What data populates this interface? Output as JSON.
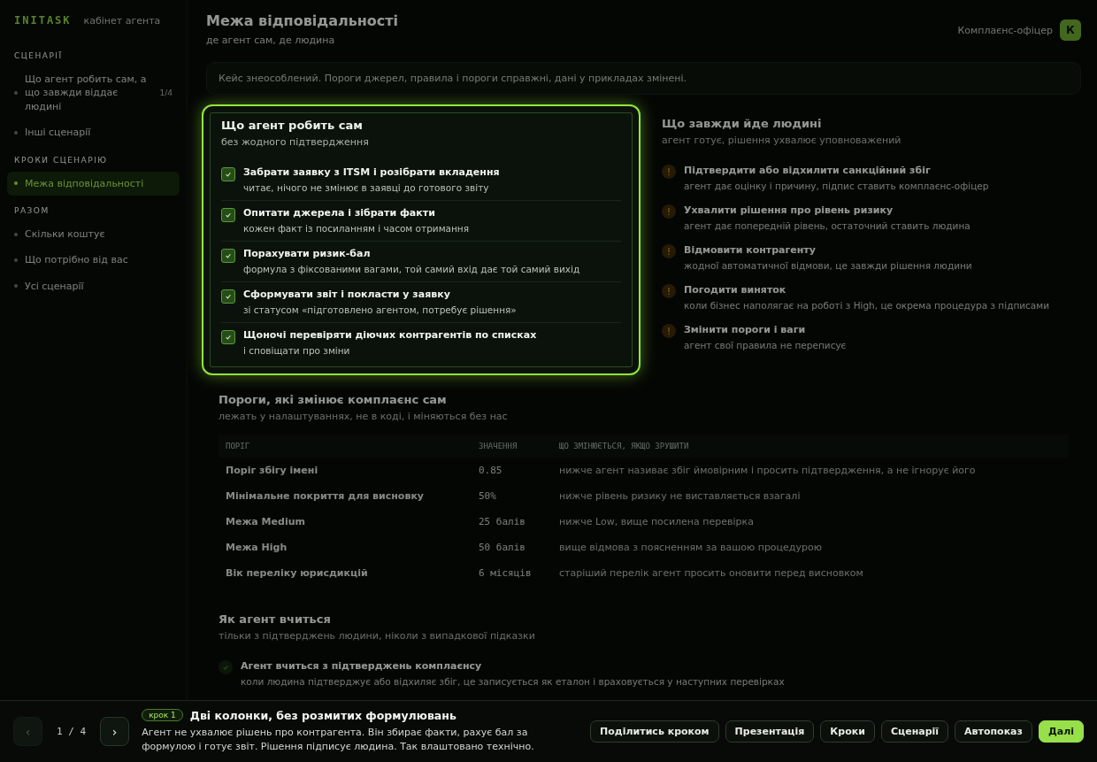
{
  "sidebar": {
    "logo": "INITASK",
    "subtitle": "кабінет агента",
    "sections": [
      {
        "title": "СЦЕНАРІЇ",
        "items": [
          {
            "label": "Що агент робить сам, а що завжди віддає людині",
            "badge": "1/4",
            "selected": false
          },
          {
            "label": "Інші сценарії",
            "selected": false
          }
        ]
      },
      {
        "title": "КРОКИ СЦЕНАРІЮ",
        "items": [
          {
            "label": "Межа відповідальності",
            "selected": true
          }
        ]
      },
      {
        "title": "РАЗОМ",
        "items": [
          {
            "label": "Скільки коштує",
            "selected": false
          },
          {
            "label": "Що потрібно від вас",
            "selected": false
          },
          {
            "label": "Усі сценарії",
            "selected": false
          }
        ]
      }
    ]
  },
  "header": {
    "title": "Межа відповідальності",
    "subtitle": "де агент сам, де людина",
    "user": {
      "name": "Комплаєнс-офіцер",
      "initial": "К"
    }
  },
  "notice": "Кейс знеособлений. Пороги джерел, правила і пороги справжні, дані у прикладах змінені.",
  "agent_column": {
    "spotlight": true,
    "title": "Що агент робить сам",
    "subtitle": "без жодного підтвердження",
    "items": [
      {
        "title": "Забрати заявку з ITSM і розібрати вкладення",
        "detail": "читає, нічого не змінює в заявці до готового звіту",
        "checked": true
      },
      {
        "title": "Опитати джерела і зібрати факти",
        "detail": "кожен факт із посиланням і часом отримання",
        "checked": true
      },
      {
        "title": "Порахувати ризик-бал",
        "detail": "формула з фіксованими вагами, той самий вхід дає той самий вихід",
        "checked": true
      },
      {
        "title": "Сформувати звіт і покласти у заявку",
        "detail": "зі статусом «підготовлено агентом, потребує рішення»",
        "checked": true
      },
      {
        "title": "Щоночі перевіряти діючих контрагентів по списках",
        "detail": "і сповіщати про зміни",
        "checked": true
      }
    ]
  },
  "human_column": {
    "title": "Що завжди йде людині",
    "subtitle": "агент готує, рішення ухвалює уповноважений",
    "items": [
      {
        "marker": "!",
        "title": "Підтвердити або відхилити санкційний збіг",
        "detail": "агент дає оцінку і причину, підпис ставить комплаєнс-офіцер"
      },
      {
        "marker": "!",
        "title": "Ухвалити рішення про рівень ризику",
        "detail": "агент дає попередній рівень, остаточний ставить людина"
      },
      {
        "marker": "!",
        "title": "Відмовити контрагенту",
        "detail": "жодної автоматичної відмови, це завжди рішення людини"
      },
      {
        "marker": "!",
        "title": "Погодити виняток",
        "detail": "коли бізнес наполягає на роботі з High, це окрема процедура з підписами"
      },
      {
        "marker": "!",
        "title": "Змінити пороги і ваги",
        "detail": "агент свої правила не переписує"
      }
    ]
  },
  "thresholds": {
    "title": "Пороги, які змінює комплаєнс сам",
    "subtitle": "лежать у налаштуваннях, не в коді, і міняються без нас",
    "columns": [
      "ПОРІГ",
      "ЗНАЧЕННЯ",
      "ЩО ЗМІНЮЄТЬСЯ, ЯКЩО ЗРУШИТИ"
    ],
    "rows": [
      [
        "Поріг збігу імені",
        "0.85",
        "нижче агент називає збіг ймовірним і просить підтвердження, а не ігнорує його"
      ],
      [
        "Мінімальне покриття для висновку",
        "50%",
        "нижче рівень ризику не виставляється взагалі"
      ],
      [
        "Межа Medium",
        "25 балів",
        "нижче Low, вище посилена перевірка"
      ],
      [
        "Межа High",
        "50 балів",
        "вище відмова з поясненням за вашою процедурою"
      ],
      [
        "Вік переліку юрисдикцій",
        "6 місяців",
        "старіший перелік агент просить оновити перед висновком"
      ]
    ]
  },
  "learning": {
    "title": "Як агент вчиться",
    "subtitle": "тільки з підтверджень людини, ніколи з випадкової підказки",
    "items": [
      {
        "title": "Агент вчиться з підтверджень комплаєнсу",
        "detail": "коли людина підтверджує або відхиляє збіг, це записується як еталон і враховується у наступних перевірках"
      }
    ]
  },
  "tour": {
    "prev": {
      "label": "‹",
      "disabled": true
    },
    "counter": "1 / 4",
    "next": {
      "label": "›",
      "disabled": false
    },
    "step": "крок 1",
    "title": "Дві колонки, без розмитих формулювань",
    "text": "Агент не ухвалює рішень про контрагента. Він збирає факти, рахує бал за формулою і готує звіт. Рішення підписує людина. Так влаштовано технічно.",
    "buttons": [
      {
        "label": "Поділитись кроком",
        "primary": false
      },
      {
        "label": "Презентація",
        "primary": false
      },
      {
        "label": "Кроки",
        "primary": false
      },
      {
        "label": "Сценарії",
        "primary": false
      },
      {
        "label": "Автопоказ",
        "primary": false
      },
      {
        "label": "Далі",
        "primary": true
      }
    ]
  }
}
